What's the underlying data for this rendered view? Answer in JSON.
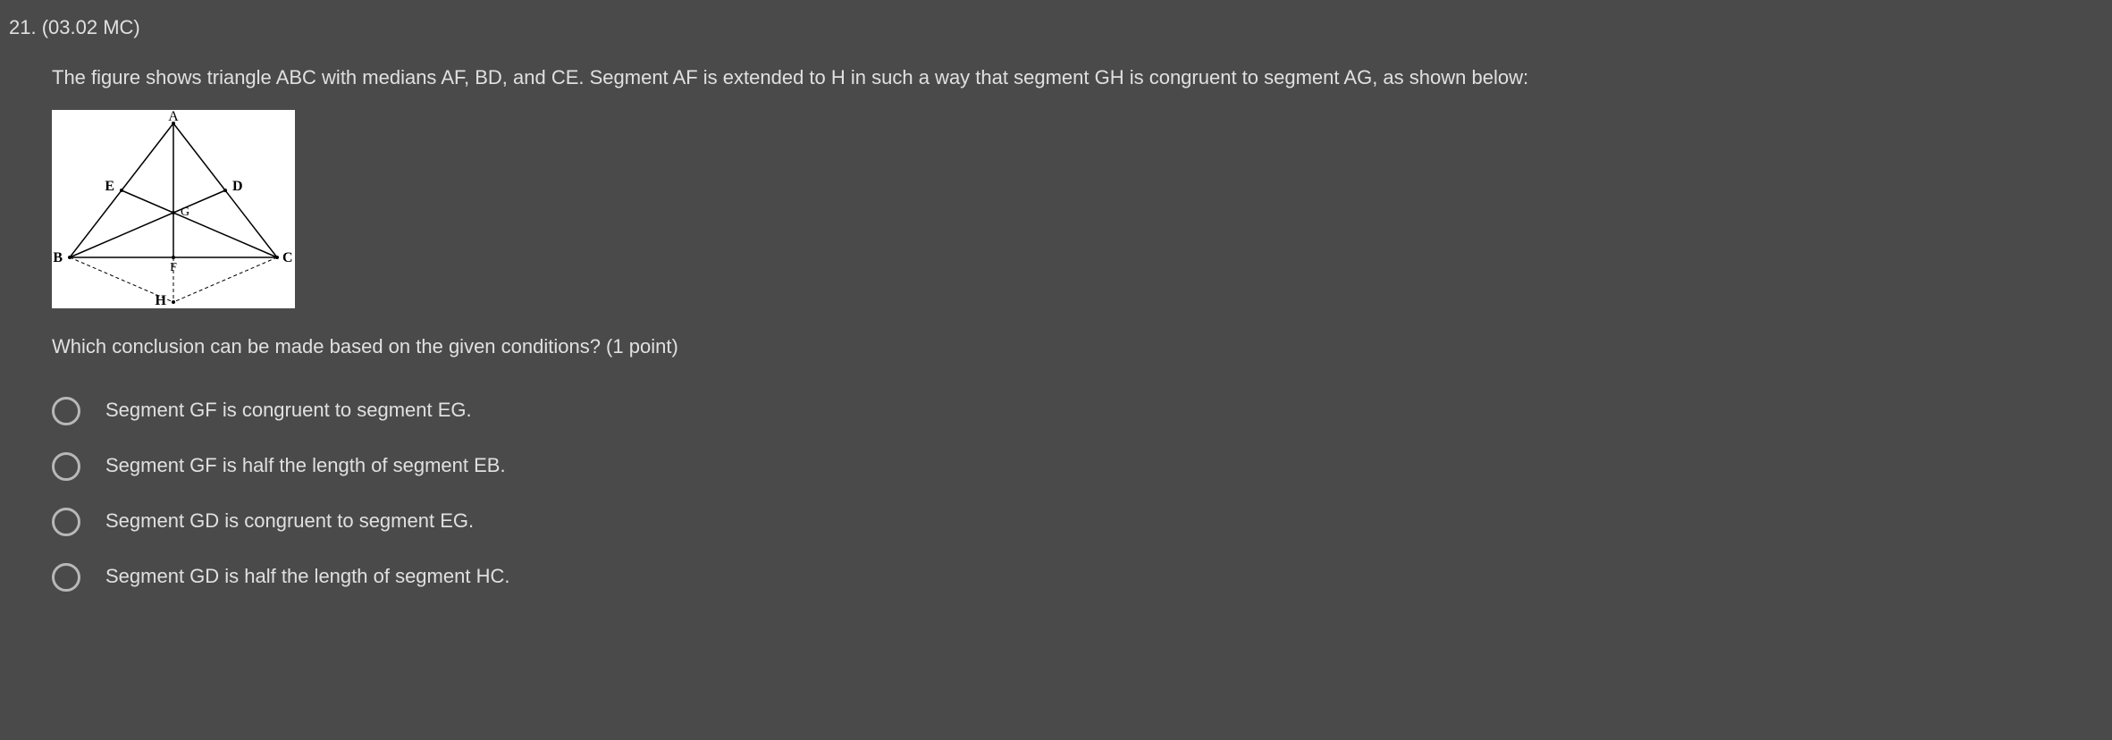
{
  "question": {
    "number": "21. (03.02 MC)",
    "text": "The figure shows triangle ABC with medians AF, BD, and CE. Segment AF is extended to H in such a way that segment GH is congruent to segment AG, as shown below:",
    "prompt": "Which conclusion can be made based on the given conditions? (1 point)",
    "figure_labels": {
      "A": "A",
      "B": "B",
      "C": "C",
      "D": "D",
      "E": "E",
      "F": "F",
      "G": "G",
      "H": "H"
    }
  },
  "options": [
    {
      "label": "Segment GF is congruent to segment EG."
    },
    {
      "label": "Segment GF is half the length of segment EB."
    },
    {
      "label": "Segment GD is congruent to segment EG."
    },
    {
      "label": "Segment GD is half the length of segment HC."
    }
  ]
}
